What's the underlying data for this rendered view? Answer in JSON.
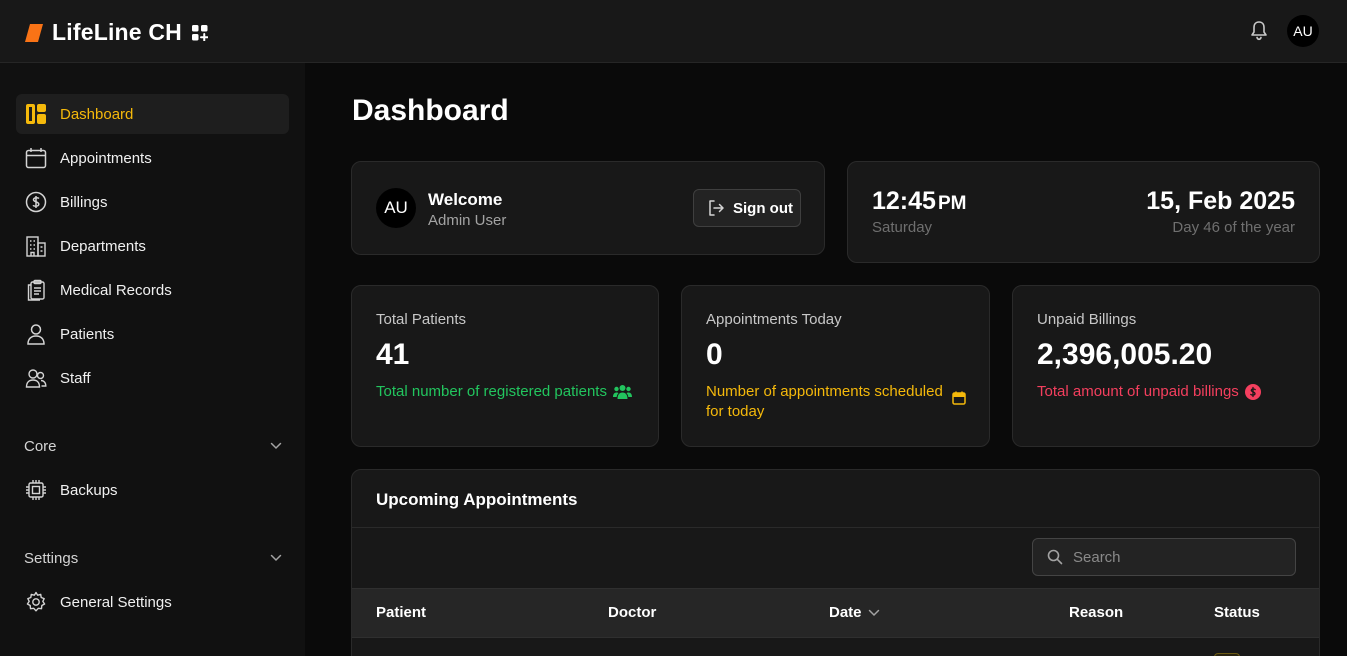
{
  "app": {
    "name": "LifeLine CH",
    "user_initials": "AU",
    "brand_color": "#f97316",
    "accent_color": "#f5b90b"
  },
  "topbar": {
    "notification_icon": "bell-icon",
    "avatar_initials": "AU"
  },
  "sidebar": {
    "items": [
      {
        "label": "Dashboard",
        "icon": "dashboard-icon",
        "active": true
      },
      {
        "label": "Appointments",
        "icon": "calendar-icon"
      },
      {
        "label": "Billings",
        "icon": "dollar-circle-icon"
      },
      {
        "label": "Departments",
        "icon": "building-icon"
      },
      {
        "label": "Medical Records",
        "icon": "clipboard-icon"
      },
      {
        "label": "Patients",
        "icon": "user-icon"
      },
      {
        "label": "Staff",
        "icon": "users-icon"
      }
    ],
    "sections": [
      {
        "label": "Core",
        "items": [
          {
            "label": "Backups",
            "icon": "chip-icon"
          }
        ]
      },
      {
        "label": "Settings",
        "items": [
          {
            "label": "General Settings",
            "icon": "gear-icon"
          }
        ]
      }
    ]
  },
  "main": {
    "title": "Dashboard",
    "welcome": {
      "avatar": "AU",
      "title": "Welcome",
      "name": "Admin User",
      "signout_label": "Sign out"
    },
    "clock": {
      "time": "12:45",
      "ampm": "PM",
      "weekday": "Saturday",
      "date": "15, Feb 2025",
      "day_of_year": "Day 46 of the year"
    },
    "stats": [
      {
        "label": "Total Patients",
        "value": "41",
        "desc": "Total number of registered patients",
        "color": "#22c55e",
        "icon": "users-group-icon"
      },
      {
        "label": "Appointments Today",
        "value": "0",
        "desc": "Number of appointments scheduled for today",
        "color": "#f5b90b",
        "icon": "calendar-small-icon"
      },
      {
        "label": "Unpaid Billings",
        "value": "2,396,005.20",
        "desc": "Total amount of unpaid billings",
        "color": "#f43f5e",
        "icon": "dollar-badge-icon"
      }
    ],
    "upcoming": {
      "title": "Upcoming Appointments",
      "search_placeholder": "Search",
      "columns": [
        "Patient",
        "Doctor",
        "Date",
        "Reason",
        "Status"
      ]
    }
  }
}
